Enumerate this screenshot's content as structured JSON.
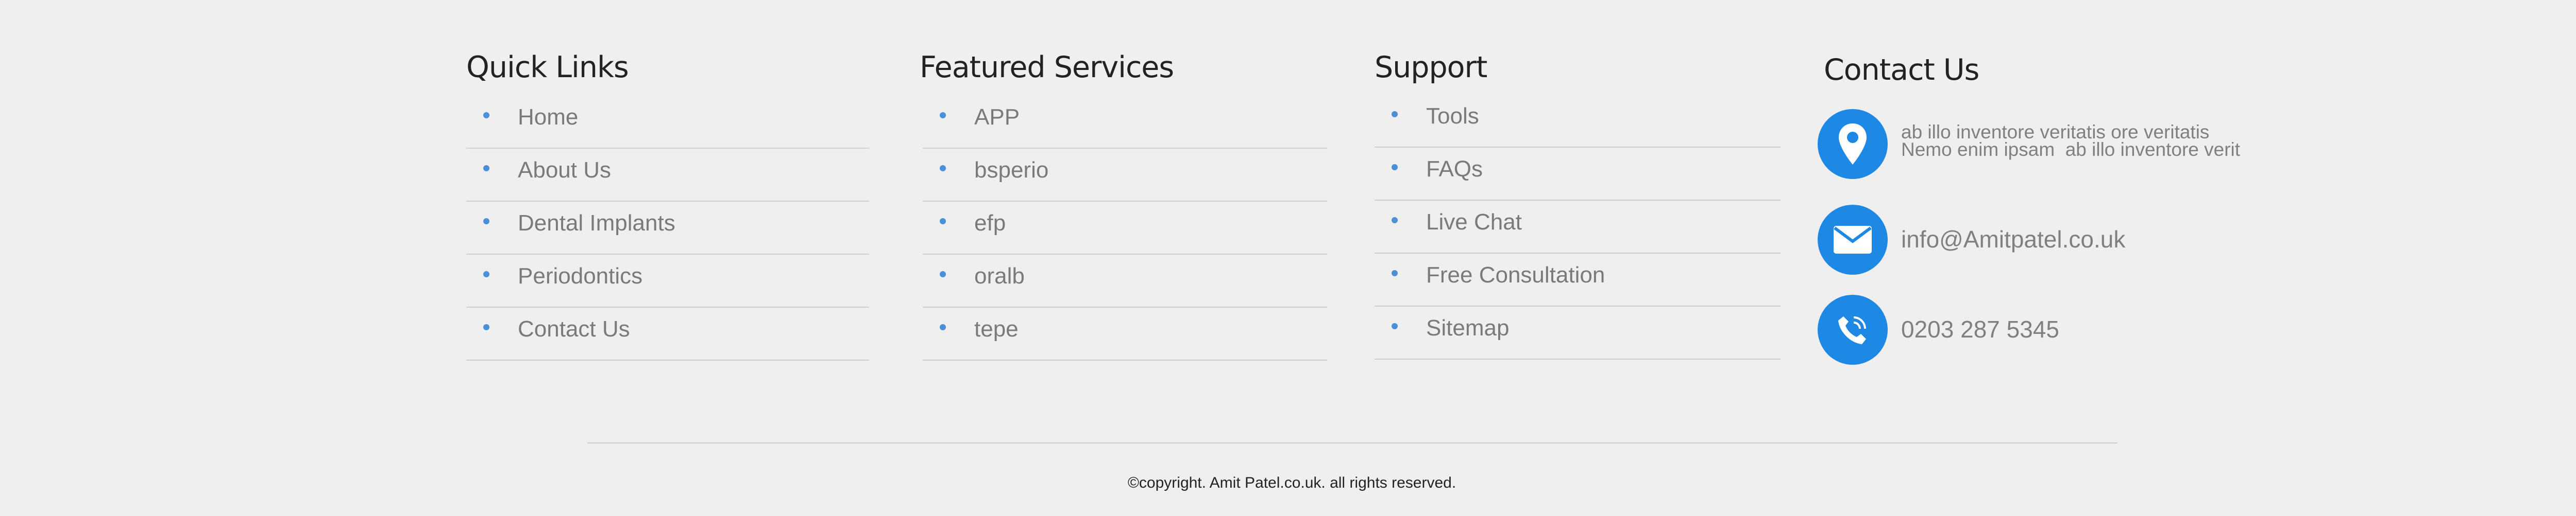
{
  "columns": [
    {
      "title": "Quick Links",
      "items": [
        "Home",
        "About Us",
        "Dental Implants",
        "Periodontics",
        "Contact Us"
      ]
    },
    {
      "title": "Featured Services",
      "items": [
        "APP",
        "bsperio",
        "efp",
        "oralb",
        "tepe"
      ]
    },
    {
      "title": "Support",
      "items": [
        "Tools",
        "FAQs",
        "Live Chat",
        "Free Consultation",
        "Sitemap"
      ]
    }
  ],
  "contact": {
    "title": "Contact Us",
    "address_line1": "ab illo inventore veritatis ore veritatis",
    "address_line2": "Nemo enim ipsam  ab illo inventore verit",
    "email": "info@Amitpatel.co.uk",
    "phone": "0203 287 5345",
    "icons": [
      "map-pin-icon",
      "envelope-icon",
      "phone-icon"
    ],
    "icon_color": "#1e88e5"
  },
  "footer": {
    "copyright": "©copyright. Amit Patel.co.uk. all rights reserved."
  },
  "colors": {
    "background": "#efefef",
    "bullet": "#4a90d9",
    "link_text": "#7a7a7a"
  }
}
